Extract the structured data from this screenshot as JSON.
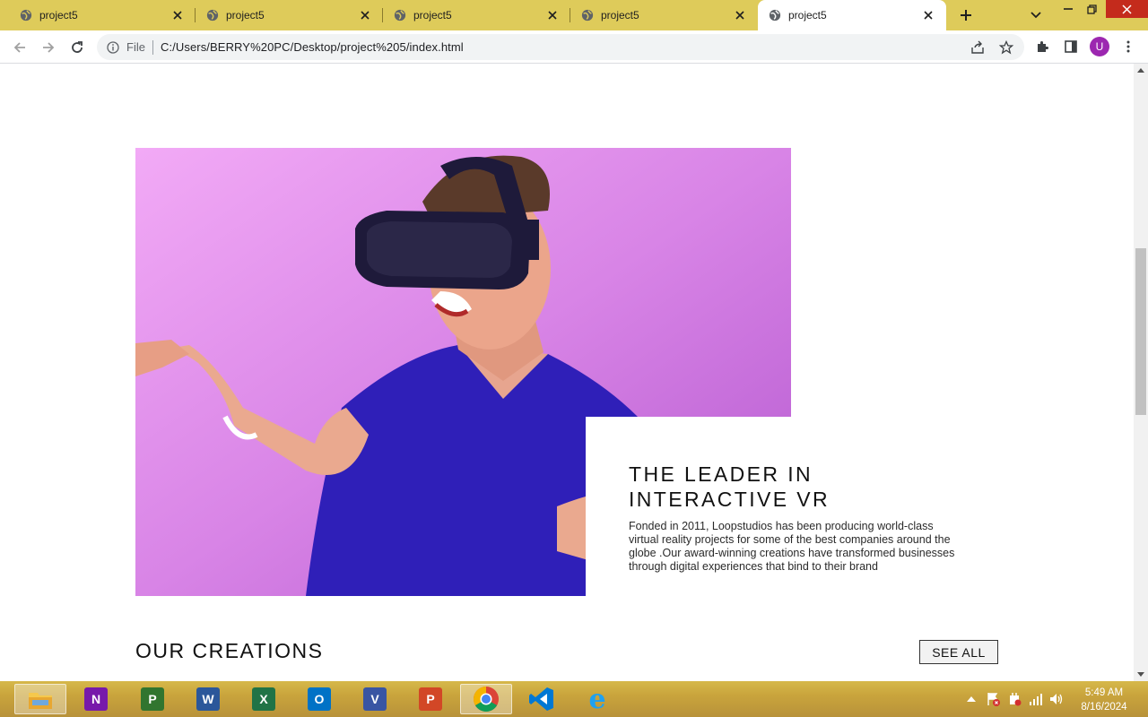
{
  "browser": {
    "tabs": [
      {
        "title": "project5",
        "active": false
      },
      {
        "title": "project5",
        "active": false
      },
      {
        "title": "project5",
        "active": false
      },
      {
        "title": "project5",
        "active": false
      },
      {
        "title": "project5",
        "active": true
      }
    ],
    "address": {
      "scheme_label": "File",
      "url": "C:/Users/BERRY%20PC/Desktop/project%205/index.html"
    },
    "profile_initial": "U"
  },
  "page": {
    "hero": {
      "image_icon": "vr-headset-man-photo",
      "heading": "THE LEADER IN INTERACTIVE VR",
      "body": "Fonded in 2011, Loopstudios has been producing world-class virtual reality projects for some of the best companies around the globe .Our award-winning creations have transformed businesses through digital experiences that bind to their brand"
    },
    "creations": {
      "title": "OUR CREATIONS",
      "see_all_label": "SEE ALL"
    }
  },
  "taskbar": {
    "apps": [
      {
        "name": "file-explorer",
        "letter": ""
      },
      {
        "name": "onenote",
        "letter": "N",
        "color": "#7719aa"
      },
      {
        "name": "project",
        "letter": "P",
        "color": "#31752f"
      },
      {
        "name": "word",
        "letter": "W",
        "color": "#2b579a"
      },
      {
        "name": "excel",
        "letter": "X",
        "color": "#217346"
      },
      {
        "name": "outlook",
        "letter": "O",
        "color": "#0072c6"
      },
      {
        "name": "visio",
        "letter": "V",
        "color": "#3955a3"
      },
      {
        "name": "powerpoint",
        "letter": "P",
        "color": "#d24726"
      },
      {
        "name": "chrome",
        "letter": ""
      },
      {
        "name": "vscode",
        "letter": ""
      },
      {
        "name": "internet-explorer",
        "letter": "e"
      }
    ],
    "clock": {
      "time": "5:49 AM",
      "date": "8/16/2024"
    }
  }
}
